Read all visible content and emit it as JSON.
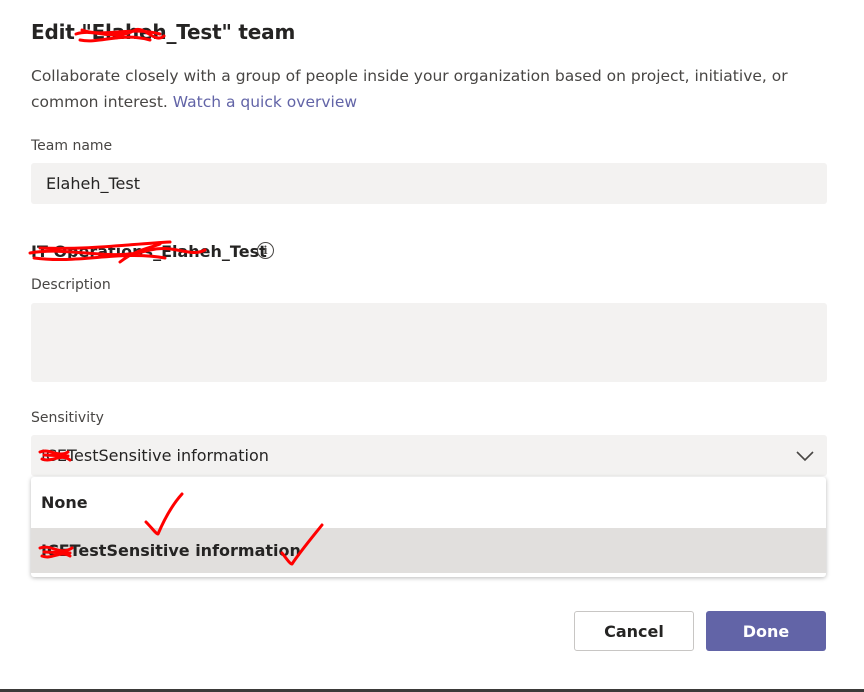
{
  "dialog": {
    "title_prefix": "Edit \"",
    "title_redacted": "Elaheh",
    "title_suffix": "_Test\" team",
    "description_text": "Collaborate closely with a group of people inside your organization based on project, initiative, or common interest.",
    "overview_link": "Watch a quick overview"
  },
  "team_name": {
    "label": "Team name",
    "value": "Elaheh_Test"
  },
  "group_heading": {
    "redacted_prefix": "IT Operations_Elaheh",
    "suffix": "_Test",
    "info_icon": "info-icon"
  },
  "description": {
    "label": "Description",
    "value": ""
  },
  "sensitivity": {
    "label": "Sensitivity",
    "redacted_prefix": "ICE",
    "selected_value": "TestSensitive information",
    "chevron_icon": "chevron-down-icon",
    "options": [
      {
        "label": "None"
      },
      {
        "redacted_prefix": "ICE",
        "label": "TestSensitive information"
      }
    ]
  },
  "buttons": {
    "cancel": "Cancel",
    "done": "Done"
  },
  "colors": {
    "accent": "#6264a7",
    "input_bg": "#f3f2f1",
    "hover_bg": "#e1dfdd",
    "annotation": "#ff0000"
  }
}
